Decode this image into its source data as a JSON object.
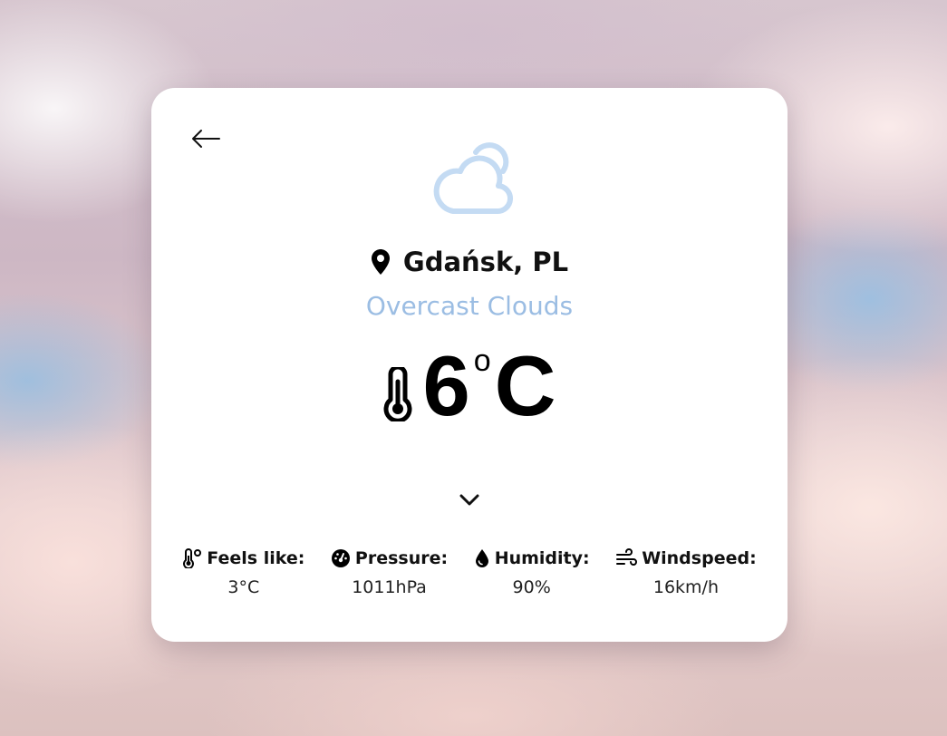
{
  "weather": {
    "location": "Gdańsk, PL",
    "description": "Overcast Clouds",
    "temperature": "6",
    "degree_symbol": "o",
    "unit": "C",
    "condition_icon": "cloud-icon",
    "details": [
      {
        "label": "Feels like:",
        "value": "3°C",
        "icon": "thermometer-degree-icon"
      },
      {
        "label": "Pressure:",
        "value": "1011hPa",
        "icon": "gauge-icon"
      },
      {
        "label": "Humidity:",
        "value": "90%",
        "icon": "droplet-icon"
      },
      {
        "label": "Windspeed:",
        "value": "16km/h",
        "icon": "wind-icon"
      }
    ]
  },
  "colors": {
    "description": "#9bbde3",
    "cloud_icon": "#c4dbf3",
    "card": "#ffffff"
  }
}
